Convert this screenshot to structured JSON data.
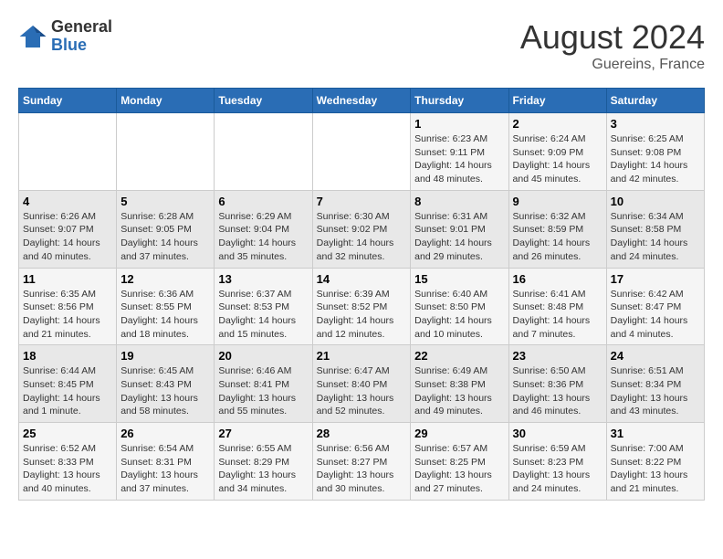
{
  "header": {
    "logo_general": "General",
    "logo_blue": "Blue",
    "month_year": "August 2024",
    "location": "Guereins, France"
  },
  "days_of_week": [
    "Sunday",
    "Monday",
    "Tuesday",
    "Wednesday",
    "Thursday",
    "Friday",
    "Saturday"
  ],
  "weeks": [
    [
      {
        "day": "",
        "info": ""
      },
      {
        "day": "",
        "info": ""
      },
      {
        "day": "",
        "info": ""
      },
      {
        "day": "",
        "info": ""
      },
      {
        "day": "1",
        "info": "Sunrise: 6:23 AM\nSunset: 9:11 PM\nDaylight: 14 hours and 48 minutes."
      },
      {
        "day": "2",
        "info": "Sunrise: 6:24 AM\nSunset: 9:09 PM\nDaylight: 14 hours and 45 minutes."
      },
      {
        "day": "3",
        "info": "Sunrise: 6:25 AM\nSunset: 9:08 PM\nDaylight: 14 hours and 42 minutes."
      }
    ],
    [
      {
        "day": "4",
        "info": "Sunrise: 6:26 AM\nSunset: 9:07 PM\nDaylight: 14 hours and 40 minutes."
      },
      {
        "day": "5",
        "info": "Sunrise: 6:28 AM\nSunset: 9:05 PM\nDaylight: 14 hours and 37 minutes."
      },
      {
        "day": "6",
        "info": "Sunrise: 6:29 AM\nSunset: 9:04 PM\nDaylight: 14 hours and 35 minutes."
      },
      {
        "day": "7",
        "info": "Sunrise: 6:30 AM\nSunset: 9:02 PM\nDaylight: 14 hours and 32 minutes."
      },
      {
        "day": "8",
        "info": "Sunrise: 6:31 AM\nSunset: 9:01 PM\nDaylight: 14 hours and 29 minutes."
      },
      {
        "day": "9",
        "info": "Sunrise: 6:32 AM\nSunset: 8:59 PM\nDaylight: 14 hours and 26 minutes."
      },
      {
        "day": "10",
        "info": "Sunrise: 6:34 AM\nSunset: 8:58 PM\nDaylight: 14 hours and 24 minutes."
      }
    ],
    [
      {
        "day": "11",
        "info": "Sunrise: 6:35 AM\nSunset: 8:56 PM\nDaylight: 14 hours and 21 minutes."
      },
      {
        "day": "12",
        "info": "Sunrise: 6:36 AM\nSunset: 8:55 PM\nDaylight: 14 hours and 18 minutes."
      },
      {
        "day": "13",
        "info": "Sunrise: 6:37 AM\nSunset: 8:53 PM\nDaylight: 14 hours and 15 minutes."
      },
      {
        "day": "14",
        "info": "Sunrise: 6:39 AM\nSunset: 8:52 PM\nDaylight: 14 hours and 12 minutes."
      },
      {
        "day": "15",
        "info": "Sunrise: 6:40 AM\nSunset: 8:50 PM\nDaylight: 14 hours and 10 minutes."
      },
      {
        "day": "16",
        "info": "Sunrise: 6:41 AM\nSunset: 8:48 PM\nDaylight: 14 hours and 7 minutes."
      },
      {
        "day": "17",
        "info": "Sunrise: 6:42 AM\nSunset: 8:47 PM\nDaylight: 14 hours and 4 minutes."
      }
    ],
    [
      {
        "day": "18",
        "info": "Sunrise: 6:44 AM\nSunset: 8:45 PM\nDaylight: 14 hours and 1 minute."
      },
      {
        "day": "19",
        "info": "Sunrise: 6:45 AM\nSunset: 8:43 PM\nDaylight: 13 hours and 58 minutes."
      },
      {
        "day": "20",
        "info": "Sunrise: 6:46 AM\nSunset: 8:41 PM\nDaylight: 13 hours and 55 minutes."
      },
      {
        "day": "21",
        "info": "Sunrise: 6:47 AM\nSunset: 8:40 PM\nDaylight: 13 hours and 52 minutes."
      },
      {
        "day": "22",
        "info": "Sunrise: 6:49 AM\nSunset: 8:38 PM\nDaylight: 13 hours and 49 minutes."
      },
      {
        "day": "23",
        "info": "Sunrise: 6:50 AM\nSunset: 8:36 PM\nDaylight: 13 hours and 46 minutes."
      },
      {
        "day": "24",
        "info": "Sunrise: 6:51 AM\nSunset: 8:34 PM\nDaylight: 13 hours and 43 minutes."
      }
    ],
    [
      {
        "day": "25",
        "info": "Sunrise: 6:52 AM\nSunset: 8:33 PM\nDaylight: 13 hours and 40 minutes."
      },
      {
        "day": "26",
        "info": "Sunrise: 6:54 AM\nSunset: 8:31 PM\nDaylight: 13 hours and 37 minutes."
      },
      {
        "day": "27",
        "info": "Sunrise: 6:55 AM\nSunset: 8:29 PM\nDaylight: 13 hours and 34 minutes."
      },
      {
        "day": "28",
        "info": "Sunrise: 6:56 AM\nSunset: 8:27 PM\nDaylight: 13 hours and 30 minutes."
      },
      {
        "day": "29",
        "info": "Sunrise: 6:57 AM\nSunset: 8:25 PM\nDaylight: 13 hours and 27 minutes."
      },
      {
        "day": "30",
        "info": "Sunrise: 6:59 AM\nSunset: 8:23 PM\nDaylight: 13 hours and 24 minutes."
      },
      {
        "day": "31",
        "info": "Sunrise: 7:00 AM\nSunset: 8:22 PM\nDaylight: 13 hours and 21 minutes."
      }
    ]
  ]
}
